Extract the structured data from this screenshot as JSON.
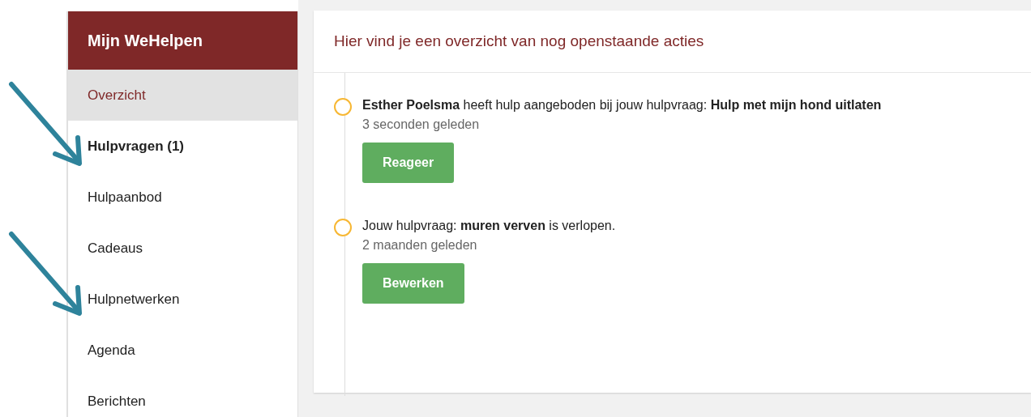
{
  "sidebar": {
    "title": "Mijn WeHelpen",
    "items": [
      {
        "label": "Overzicht",
        "selected": true,
        "unread": false
      },
      {
        "label": "Hulpvragen (1)",
        "selected": false,
        "unread": true
      },
      {
        "label": "Hulpaanbod",
        "selected": false,
        "unread": false
      },
      {
        "label": "Cadeaus",
        "selected": false,
        "unread": false
      },
      {
        "label": "Hulpnetwerken",
        "selected": false,
        "unread": false
      },
      {
        "label": "Agenda",
        "selected": false,
        "unread": false
      },
      {
        "label": "Berichten",
        "selected": false,
        "unread": false
      }
    ]
  },
  "annotations": [
    {
      "kind": "arrow"
    },
    {
      "kind": "arrow"
    }
  ],
  "main": {
    "title": "Hier vind je een overzicht van nog openstaande acties",
    "actions": [
      {
        "text": "**Esther Poelsma** heeft hulp aangeboden bij jouw hulpvraag: **Hulp met mijn hond uitlaten**",
        "time": "3 seconden geleden",
        "button": "Reageer"
      },
      {
        "text": "Jouw hulpvraag: **muren verven** is verlopen.",
        "time": "2 maanden geleden",
        "button": "Bewerken"
      }
    ]
  }
}
